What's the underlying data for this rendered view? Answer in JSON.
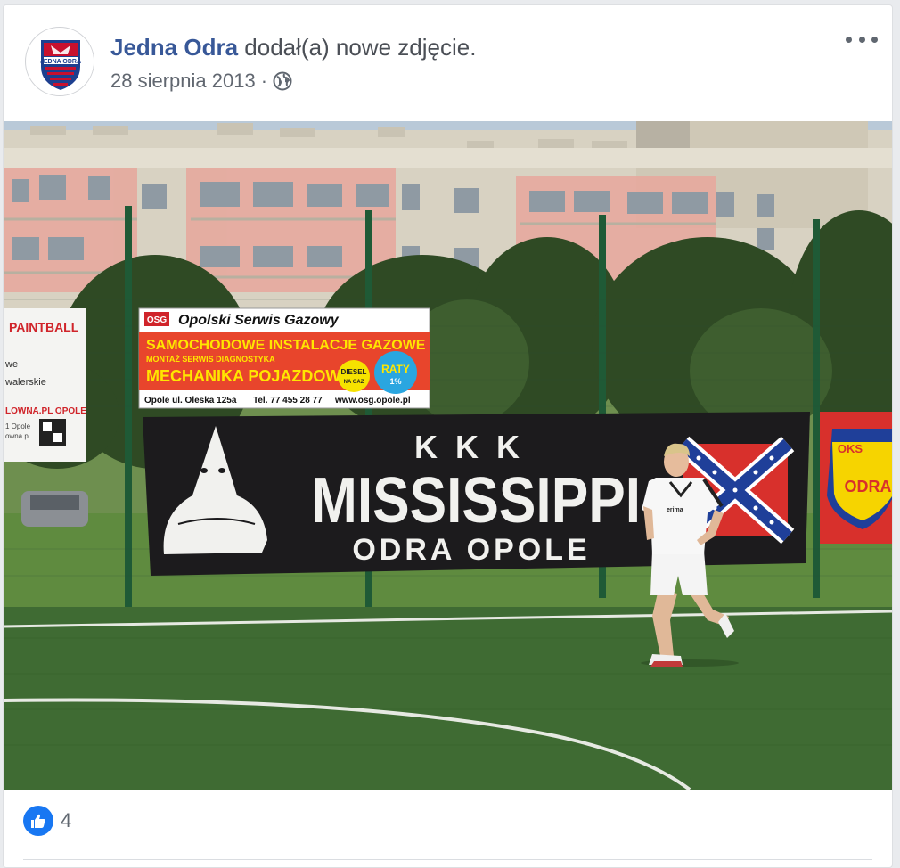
{
  "post": {
    "page_name": "Jedna Odra",
    "action_text": "dodał(a) nowe zdjęcie.",
    "date": "28 sierpnia 2013",
    "separator": "·",
    "privacy_icon": "globe-icon",
    "more_icon": "more-dots-icon",
    "avatar": {
      "text": "JEDNA ODRA",
      "colors": {
        "red": "#c8102e",
        "blue": "#1d3f8f",
        "white": "#ffffff"
      }
    }
  },
  "photo": {
    "ads": {
      "left_sign_title": "PAINTBALL",
      "left_sign_line1": "we",
      "left_sign_line2": "walerskie",
      "left_sign_url": "LOWNA.PL OPOLE",
      "left_sign_small1": "1 Opole",
      "left_sign_small2": "owna.pl",
      "osg_logo": "OSG",
      "osg_title": "Opolski Serwis Gazowy",
      "osg_line1": "SAMOCHODOWE INSTALACJE GAZOWE",
      "osg_line2": "MONTAŻ  SERWIS  DIAGNOSTYKA",
      "osg_line3": "MECHANIKA POJAZDOWA",
      "osg_diesel": "DIESEL",
      "osg_diesel2": "NA GAZ",
      "osg_raty": "RATY",
      "osg_raty2": "1%",
      "osg_address": "Opole ul. Oleska 125a",
      "osg_phone": "Tel. 77 455 28 77",
      "osg_web": "www.osg.opole.pl"
    },
    "banner": {
      "line1": "KKK",
      "line2": "MISSISSIPPI",
      "line3": "ODRA  OPOLE"
    },
    "flag_right": {
      "text1": "OKS",
      "text2": "ODRA"
    },
    "shirt_brand": "erima",
    "colors": {
      "banner": "#1c1b1d",
      "grass": "#3f6b33",
      "confederate_red": "#d8302c",
      "confederate_blue": "#1f3f99"
    }
  },
  "reactions": {
    "icon": "thumbs-up-icon",
    "count": "4"
  }
}
